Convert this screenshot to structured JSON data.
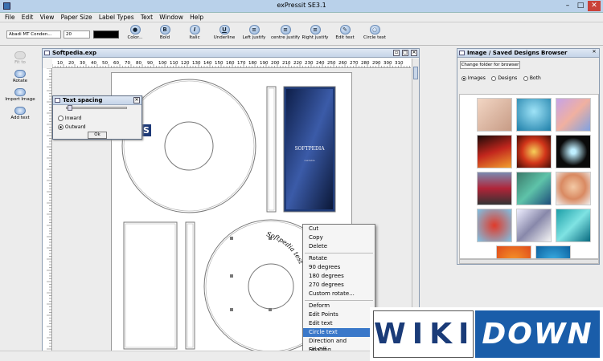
{
  "window": {
    "title": "exPressit SE3.1",
    "minimize": "–",
    "maximize": "□",
    "close": "✕"
  },
  "menu": [
    "File",
    "Edit",
    "View",
    "Paper Size",
    "Label Types",
    "Text",
    "Window",
    "Help"
  ],
  "toolbar": {
    "font": "Abadi MT Conden...",
    "size": "20",
    "color_swatch": "#000000",
    "buttons": [
      {
        "label": "Color...",
        "glyph": "●"
      },
      {
        "label": "Bold",
        "glyph": "B"
      },
      {
        "label": "Italic",
        "glyph": "I"
      },
      {
        "label": "Underline",
        "glyph": "U"
      },
      {
        "label": "Left justify",
        "glyph": "≡"
      },
      {
        "label": "centre justify",
        "glyph": "≡"
      },
      {
        "label": "Right justify",
        "glyph": "≡"
      },
      {
        "label": "Edit text",
        "glyph": "✎"
      },
      {
        "label": "Circle text",
        "glyph": "◌"
      }
    ]
  },
  "left_tools": [
    "Fit to",
    "Rotate",
    "Import Image",
    "Add text"
  ],
  "document": {
    "title": "Softpedia.exp"
  },
  "ruler_numbers": [
    "10",
    "20",
    "30",
    "40",
    "50",
    "60",
    "70",
    "80",
    "90",
    "100",
    "110",
    "120",
    "130",
    "140",
    "150",
    "160",
    "170",
    "180",
    "190",
    "200",
    "210",
    "220",
    "230",
    "240",
    "250",
    "260",
    "270",
    "280",
    "290",
    "300",
    "310"
  ],
  "label_texts": {
    "cd_top_fragment": "S",
    "circle_text": "Softpedia test",
    "cover_brand": "SOFTPEDIA",
    "cover_sub": "readable"
  },
  "dialog": {
    "title": "Text spacing",
    "inward": "Inward",
    "outward": "Outward",
    "ok": "Ok",
    "selected": "Outward"
  },
  "context_menu": {
    "items": [
      "Cut",
      "Copy",
      "Delete",
      "Rotate",
      "90 degrees",
      "180 degrees",
      "270 degrees",
      "Custom rotate...",
      "Deform",
      "Edit Points",
      "Edit text",
      "Circle text",
      "Direction and Spacing...",
      "Fill Off"
    ],
    "selected": "Circle text"
  },
  "browser": {
    "title": "Image / Saved Designs Browser",
    "change_folder": "Change folder for browser",
    "radios": [
      "Images",
      "Designs",
      "Both"
    ],
    "selected": "Images"
  },
  "watermark": {
    "left": "WIKI",
    "right": "DOWN"
  },
  "colors": {
    "accent": "#3a78c9",
    "titlebar": "#b9d1ea",
    "cover": "#1e3a78",
    "wiki_blue": "#1a5da9"
  }
}
